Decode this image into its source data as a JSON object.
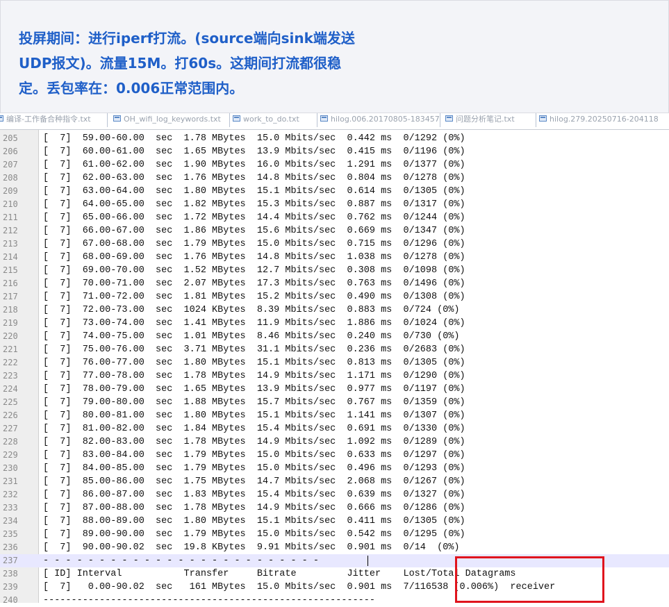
{
  "header": {
    "lines": [
      "投屏期间：进行iperf打流。(source端向sink端发送",
      "UDP报文)。流量15M。打60s。这期间打流都很稳",
      "定。丢包率在：0.006正常范围内。"
    ]
  },
  "tabs": [
    {
      "label": "编译-工作备合种指令.txt"
    },
    {
      "label": "OH_wifi_log_keywords.txt"
    },
    {
      "label": "work_to_do.txt"
    },
    {
      "label": "hilog.006.20170805-183457"
    },
    {
      "label": "问题分析笔记.txt"
    },
    {
      "label": "hilog.279.20250716-204118"
    }
  ],
  "editor": {
    "current_line": 237,
    "lines": [
      {
        "n": "205",
        "text": "[  7]  59.00-60.00  sec  1.78 MBytes  15.0 Mbits/sec  0.442 ms  0/1292 (0%)"
      },
      {
        "n": "206",
        "text": "[  7]  60.00-61.00  sec  1.65 MBytes  13.9 Mbits/sec  0.415 ms  0/1196 (0%)"
      },
      {
        "n": "207",
        "text": "[  7]  61.00-62.00  sec  1.90 MBytes  16.0 Mbits/sec  1.291 ms  0/1377 (0%)"
      },
      {
        "n": "208",
        "text": "[  7]  62.00-63.00  sec  1.76 MBytes  14.8 Mbits/sec  0.804 ms  0/1278 (0%)"
      },
      {
        "n": "209",
        "text": "[  7]  63.00-64.00  sec  1.80 MBytes  15.1 Mbits/sec  0.614 ms  0/1305 (0%)"
      },
      {
        "n": "210",
        "text": "[  7]  64.00-65.00  sec  1.82 MBytes  15.3 Mbits/sec  0.887 ms  0/1317 (0%)"
      },
      {
        "n": "211",
        "text": "[  7]  65.00-66.00  sec  1.72 MBytes  14.4 Mbits/sec  0.762 ms  0/1244 (0%)"
      },
      {
        "n": "212",
        "text": "[  7]  66.00-67.00  sec  1.86 MBytes  15.6 Mbits/sec  0.669 ms  0/1347 (0%)"
      },
      {
        "n": "213",
        "text": "[  7]  67.00-68.00  sec  1.79 MBytes  15.0 Mbits/sec  0.715 ms  0/1296 (0%)"
      },
      {
        "n": "214",
        "text": "[  7]  68.00-69.00  sec  1.76 MBytes  14.8 Mbits/sec  1.038 ms  0/1278 (0%)"
      },
      {
        "n": "215",
        "text": "[  7]  69.00-70.00  sec  1.52 MBytes  12.7 Mbits/sec  0.308 ms  0/1098 (0%)"
      },
      {
        "n": "216",
        "text": "[  7]  70.00-71.00  sec  2.07 MBytes  17.3 Mbits/sec  0.763 ms  0/1496 (0%)"
      },
      {
        "n": "217",
        "text": "[  7]  71.00-72.00  sec  1.81 MBytes  15.2 Mbits/sec  0.490 ms  0/1308 (0%)"
      },
      {
        "n": "218",
        "text": "[  7]  72.00-73.00  sec  1024 KBytes  8.39 Mbits/sec  0.883 ms  0/724 (0%)"
      },
      {
        "n": "219",
        "text": "[  7]  73.00-74.00  sec  1.41 MBytes  11.9 Mbits/sec  1.886 ms  0/1024 (0%)"
      },
      {
        "n": "220",
        "text": "[  7]  74.00-75.00  sec  1.01 MBytes  8.46 Mbits/sec  0.240 ms  0/730 (0%)"
      },
      {
        "n": "221",
        "text": "[  7]  75.00-76.00  sec  3.71 MBytes  31.1 Mbits/sec  0.236 ms  0/2683 (0%)"
      },
      {
        "n": "222",
        "text": "[  7]  76.00-77.00  sec  1.80 MBytes  15.1 Mbits/sec  0.813 ms  0/1305 (0%)"
      },
      {
        "n": "223",
        "text": "[  7]  77.00-78.00  sec  1.78 MBytes  14.9 Mbits/sec  1.171 ms  0/1290 (0%)"
      },
      {
        "n": "224",
        "text": "[  7]  78.00-79.00  sec  1.65 MBytes  13.9 Mbits/sec  0.977 ms  0/1197 (0%)"
      },
      {
        "n": "225",
        "text": "[  7]  79.00-80.00  sec  1.88 MBytes  15.7 Mbits/sec  0.767 ms  0/1359 (0%)"
      },
      {
        "n": "226",
        "text": "[  7]  80.00-81.00  sec  1.80 MBytes  15.1 Mbits/sec  1.141 ms  0/1307 (0%)"
      },
      {
        "n": "227",
        "text": "[  7]  81.00-82.00  sec  1.84 MBytes  15.4 Mbits/sec  0.691 ms  0/1330 (0%)"
      },
      {
        "n": "228",
        "text": "[  7]  82.00-83.00  sec  1.78 MBytes  14.9 Mbits/sec  1.092 ms  0/1289 (0%)"
      },
      {
        "n": "229",
        "text": "[  7]  83.00-84.00  sec  1.79 MBytes  15.0 Mbits/sec  0.633 ms  0/1297 (0%)"
      },
      {
        "n": "230",
        "text": "[  7]  84.00-85.00  sec  1.79 MBytes  15.0 Mbits/sec  0.496 ms  0/1293 (0%)"
      },
      {
        "n": "231",
        "text": "[  7]  85.00-86.00  sec  1.75 MBytes  14.7 Mbits/sec  2.068 ms  0/1267 (0%)"
      },
      {
        "n": "232",
        "text": "[  7]  86.00-87.00  sec  1.83 MBytes  15.4 Mbits/sec  0.639 ms  0/1327 (0%)"
      },
      {
        "n": "233",
        "text": "[  7]  87.00-88.00  sec  1.78 MBytes  14.9 Mbits/sec  0.666 ms  0/1286 (0%)"
      },
      {
        "n": "234",
        "text": "[  7]  88.00-89.00  sec  1.80 MBytes  15.1 Mbits/sec  0.411 ms  0/1305 (0%)"
      },
      {
        "n": "235",
        "text": "[  7]  89.00-90.00  sec  1.79 MBytes  15.0 Mbits/sec  0.542 ms  0/1295 (0%)"
      },
      {
        "n": "236",
        "text": "[  7]  90.00-90.02  sec  19.8 KBytes  9.91 Mbits/sec  0.901 ms  0/14  (0%)"
      },
      {
        "n": "237",
        "text": "- - - - - - - - - - - - - - - - - - - - - - - - -"
      },
      {
        "n": "238",
        "text": "[ ID] Interval           Transfer     Bitrate         Jitter    Lost/Total Datagrams"
      },
      {
        "n": "239",
        "text": "[  7]   0.00-90.02  sec   161 MBytes  15.0 Mbits/sec  0.901 ms  7/116538 (0.006%)  receiver"
      },
      {
        "n": "240",
        "text": "-----------------------------------------------------------"
      }
    ]
  },
  "colors": {
    "header_text": "#1f5fc8",
    "header_bg": "#f3f4f8",
    "highlight_box": "#e0141d",
    "current_line": "#e8e8ff"
  }
}
